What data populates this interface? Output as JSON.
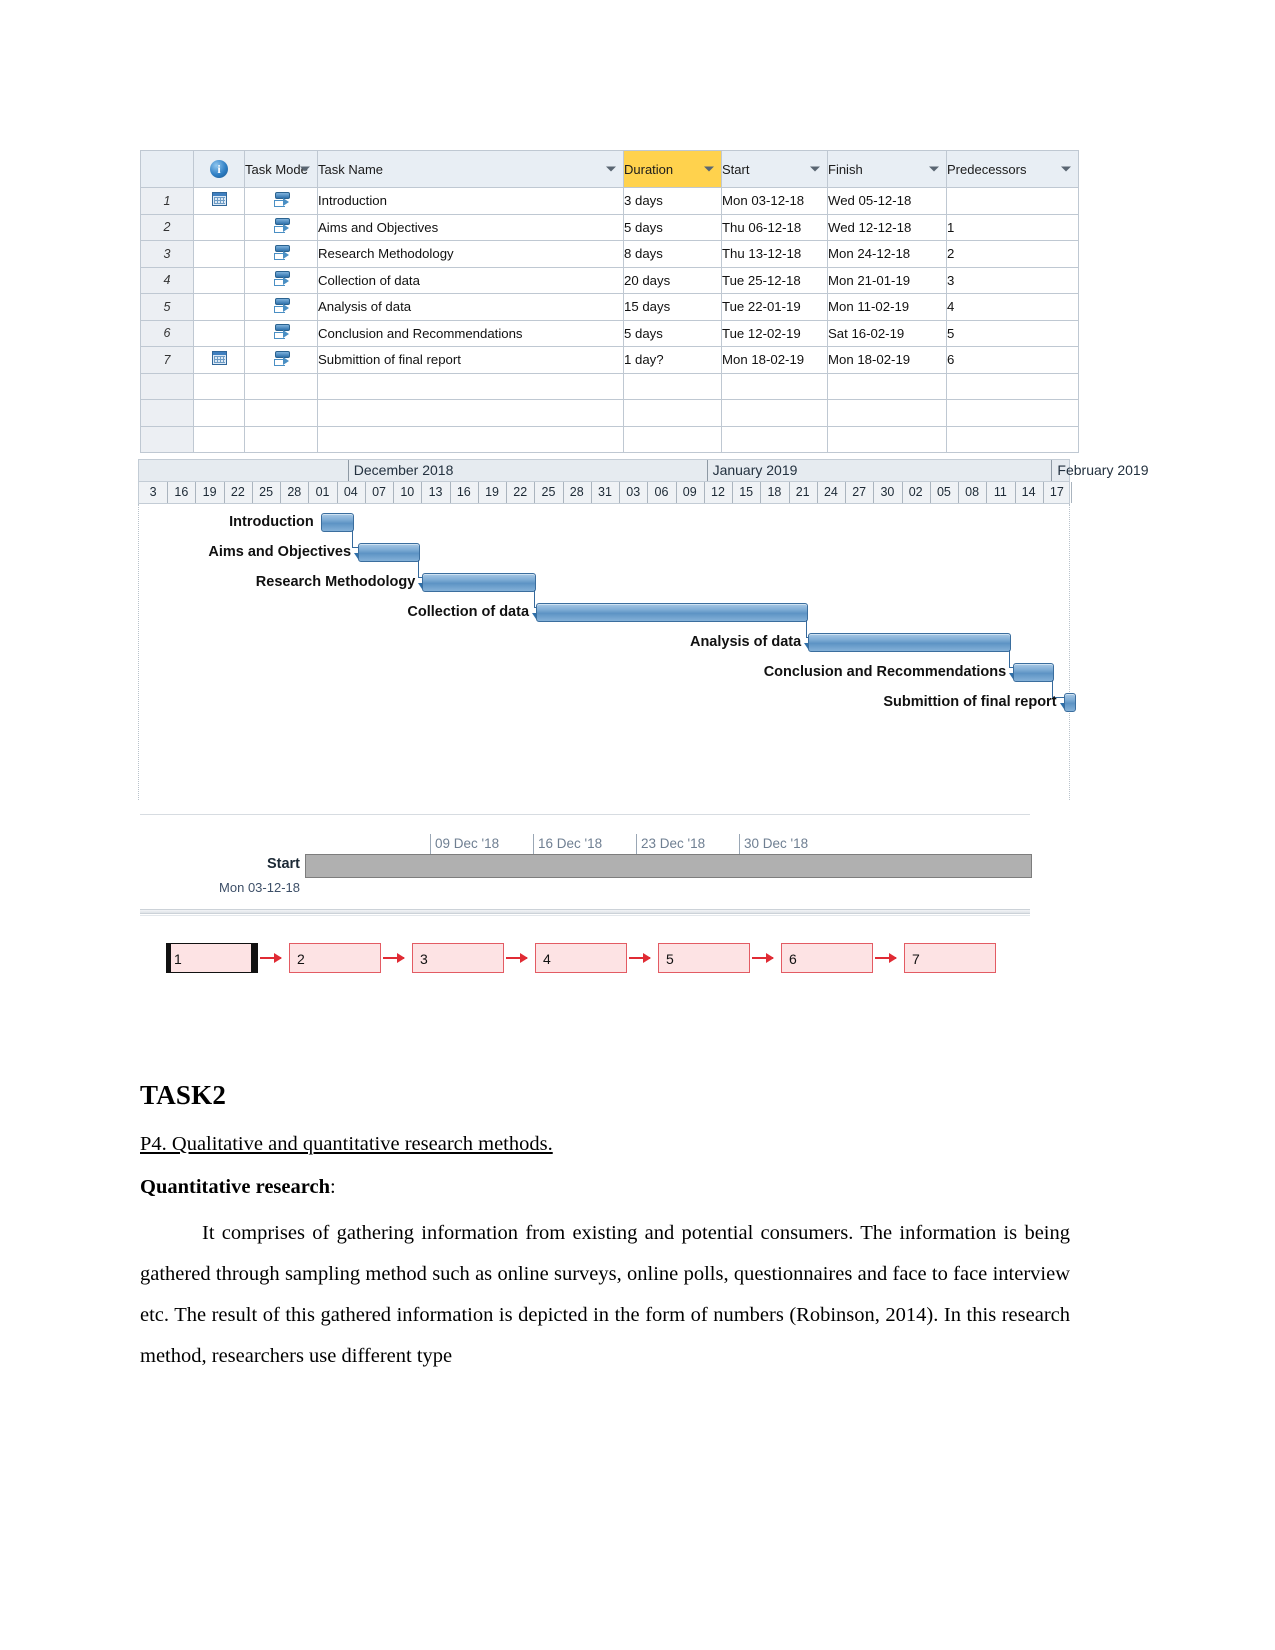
{
  "project_table": {
    "columns": [
      "",
      "info",
      "Task Mode",
      "Task Name",
      "Duration",
      "Start",
      "Finish",
      "Predecessors"
    ],
    "headers": {
      "info_icon": "info-icon",
      "task_mode": "Task Mode",
      "task_name": "Task Name",
      "duration": "Duration",
      "start": "Start",
      "finish": "Finish",
      "predecessors": "Predecessors"
    },
    "rows": [
      {
        "id": "1",
        "indicator": "calendar-icon",
        "mode": "auto-schedule-icon",
        "name": "Introduction",
        "duration": "3 days",
        "start": "Mon 03-12-18",
        "finish": "Wed 05-12-18",
        "predecessors": ""
      },
      {
        "id": "2",
        "indicator": "",
        "mode": "auto-schedule-icon",
        "name": "Aims and Objectives",
        "duration": "5 days",
        "start": "Thu 06-12-18",
        "finish": "Wed 12-12-18",
        "predecessors": "1"
      },
      {
        "id": "3",
        "indicator": "",
        "mode": "auto-schedule-icon",
        "name": "Research Methodology",
        "duration": "8 days",
        "start": "Thu 13-12-18",
        "finish": "Mon 24-12-18",
        "predecessors": "2"
      },
      {
        "id": "4",
        "indicator": "",
        "mode": "auto-schedule-icon",
        "name": "Collection of data",
        "duration": "20 days",
        "start": "Tue 25-12-18",
        "finish": "Mon 21-01-19",
        "predecessors": "3"
      },
      {
        "id": "5",
        "indicator": "",
        "mode": "auto-schedule-icon",
        "name": "Analysis of data",
        "duration": "15 days",
        "start": "Tue 22-01-19",
        "finish": "Mon 11-02-19",
        "predecessors": "4"
      },
      {
        "id": "6",
        "indicator": "",
        "mode": "auto-schedule-icon",
        "name": "Conclusion and Recommendations",
        "duration": "5 days",
        "start": "Tue 12-02-19",
        "finish": "Sat 16-02-19",
        "predecessors": "5"
      },
      {
        "id": "7",
        "indicator": "calendar-icon",
        "mode": "auto-schedule-icon",
        "name": "Submittion of final report",
        "duration": "1 day?",
        "start": "Mon 18-02-19",
        "finish": "Mon 18-02-19",
        "predecessors": "6"
      }
    ]
  },
  "gantt": {
    "months": [
      {
        "label": "December 2018",
        "left_pct": 22.4,
        "width_pct": 38.5
      },
      {
        "label": "January 2019",
        "left_pct": 60.9,
        "width_pct": 37.0
      },
      {
        "label": "February 2019",
        "left_pct": 97.9,
        "width_pct": 12.0
      }
    ],
    "day_ticks": [
      "3",
      "16",
      "19",
      "22",
      "25",
      "28",
      "01",
      "04",
      "07",
      "10",
      "13",
      "16",
      "19",
      "22",
      "25",
      "28",
      "31",
      "03",
      "06",
      "09",
      "12",
      "15",
      "18",
      "21",
      "24",
      "27",
      "30",
      "02",
      "05",
      "08",
      "11",
      "14",
      "17"
    ],
    "bars": [
      {
        "label": "Introduction",
        "left_pct": 19.5,
        "width_pct": 3.4
      },
      {
        "label": "Aims and Objectives",
        "left_pct": 23.5,
        "width_pct": 6.4
      },
      {
        "label": "Research Methodology",
        "left_pct": 30.4,
        "width_pct": 12.0
      },
      {
        "label": "Collection of data",
        "left_pct": 42.6,
        "width_pct": 29.0
      },
      {
        "label": "Analysis of data",
        "left_pct": 71.8,
        "width_pct": 21.6
      },
      {
        "label": "Conclusion and Recommendations",
        "left_pct": 93.8,
        "width_pct": 4.2
      },
      {
        "label": "Submittion of final report",
        "left_pct": 99.2,
        "width_pct": 0.9
      }
    ]
  },
  "timeline": {
    "ticks": [
      "09 Dec '18",
      "16 Dec '18",
      "23 Dec '18",
      "30 Dec '18"
    ],
    "bar_label": "Start",
    "bar_sublabel": "Mon 03-12-18"
  },
  "network_diagram": {
    "nodes": [
      "1",
      "2",
      "3",
      "4",
      "5",
      "6",
      "7"
    ],
    "accent_color": "#e02b34",
    "node_fill": "#fde3e4"
  },
  "document": {
    "heading": "TASK2",
    "subheading": "P4. Qualitative and quantitative research methods.",
    "lead_bold": "Quantitative research",
    "lead_colon": ":",
    "paragraph": "It comprises of gathering information from existing and potential consumers. The information is being gathered through sampling method such as online surveys, online polls, questionnaires and face to face interview etc. The result of this gathered information is depicted in the form of numbers (Robinson, 2014). In this research method, researchers use different type"
  }
}
